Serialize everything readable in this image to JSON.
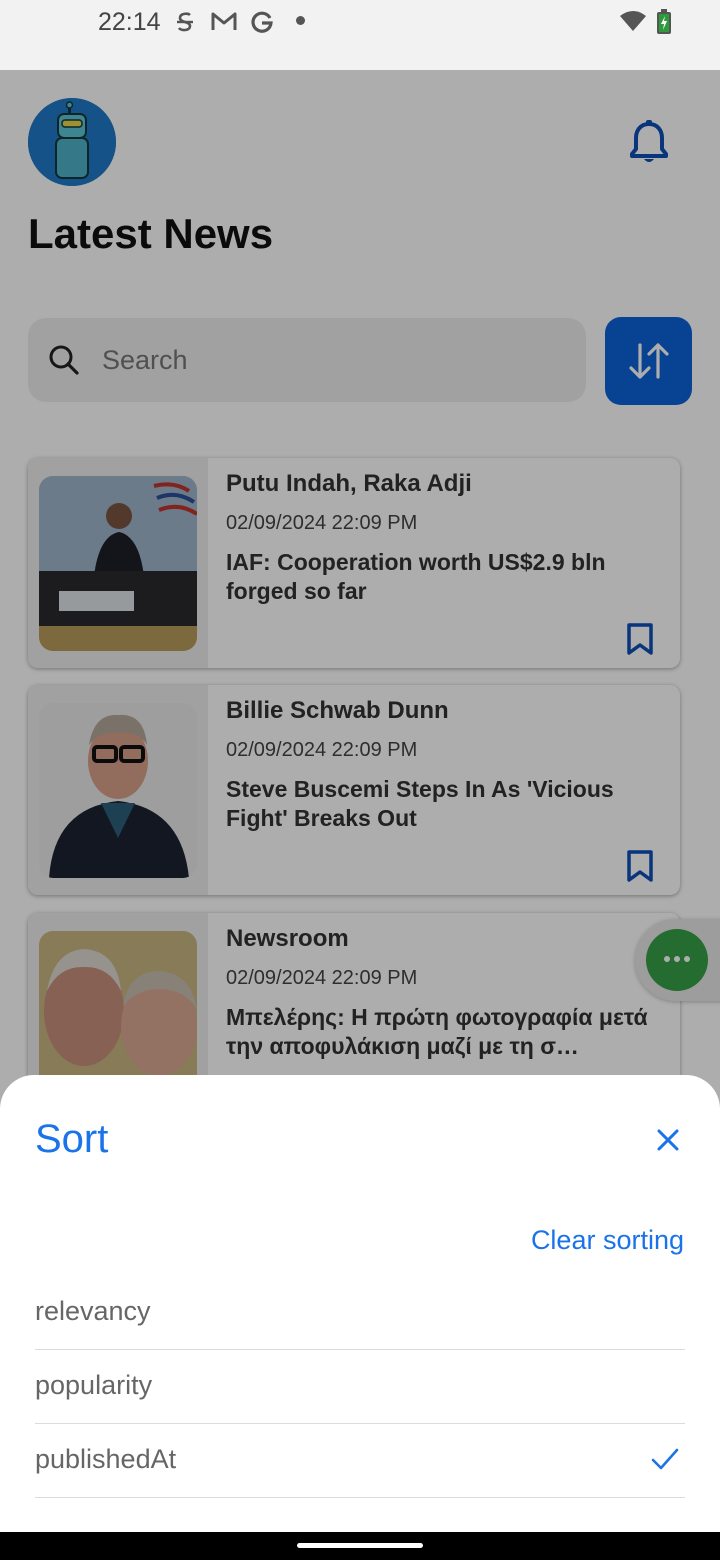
{
  "status_bar": {
    "time": "22:14"
  },
  "header": {
    "title": "Latest News"
  },
  "search": {
    "placeholder": "Search"
  },
  "articles": [
    {
      "author": "Putu Indah, Raka Adji",
      "date": "02/09/2024 22:09 PM",
      "title": "IAF: Cooperation worth US$2.9 bln forged so far"
    },
    {
      "author": "Billie Schwab Dunn",
      "date": "02/09/2024 22:09 PM",
      "title": "Steve Buscemi Steps In As 'Vicious Fight' Breaks Out"
    },
    {
      "author": "Newsroom",
      "date": "02/09/2024 22:09 PM",
      "title": "Μπελέρης: Η πρώτη φωτογραφία μετά την αποφυλάκιση μαζί με τη σ…"
    }
  ],
  "sort_sheet": {
    "title": "Sort",
    "clear_label": "Clear sorting",
    "options": [
      {
        "label": "relevancy",
        "selected": false
      },
      {
        "label": "popularity",
        "selected": false
      },
      {
        "label": "publishedAt",
        "selected": true
      }
    ]
  },
  "colors": {
    "accent": "#1a73e8",
    "button": "#0d63d9",
    "fab": "#37a049"
  }
}
